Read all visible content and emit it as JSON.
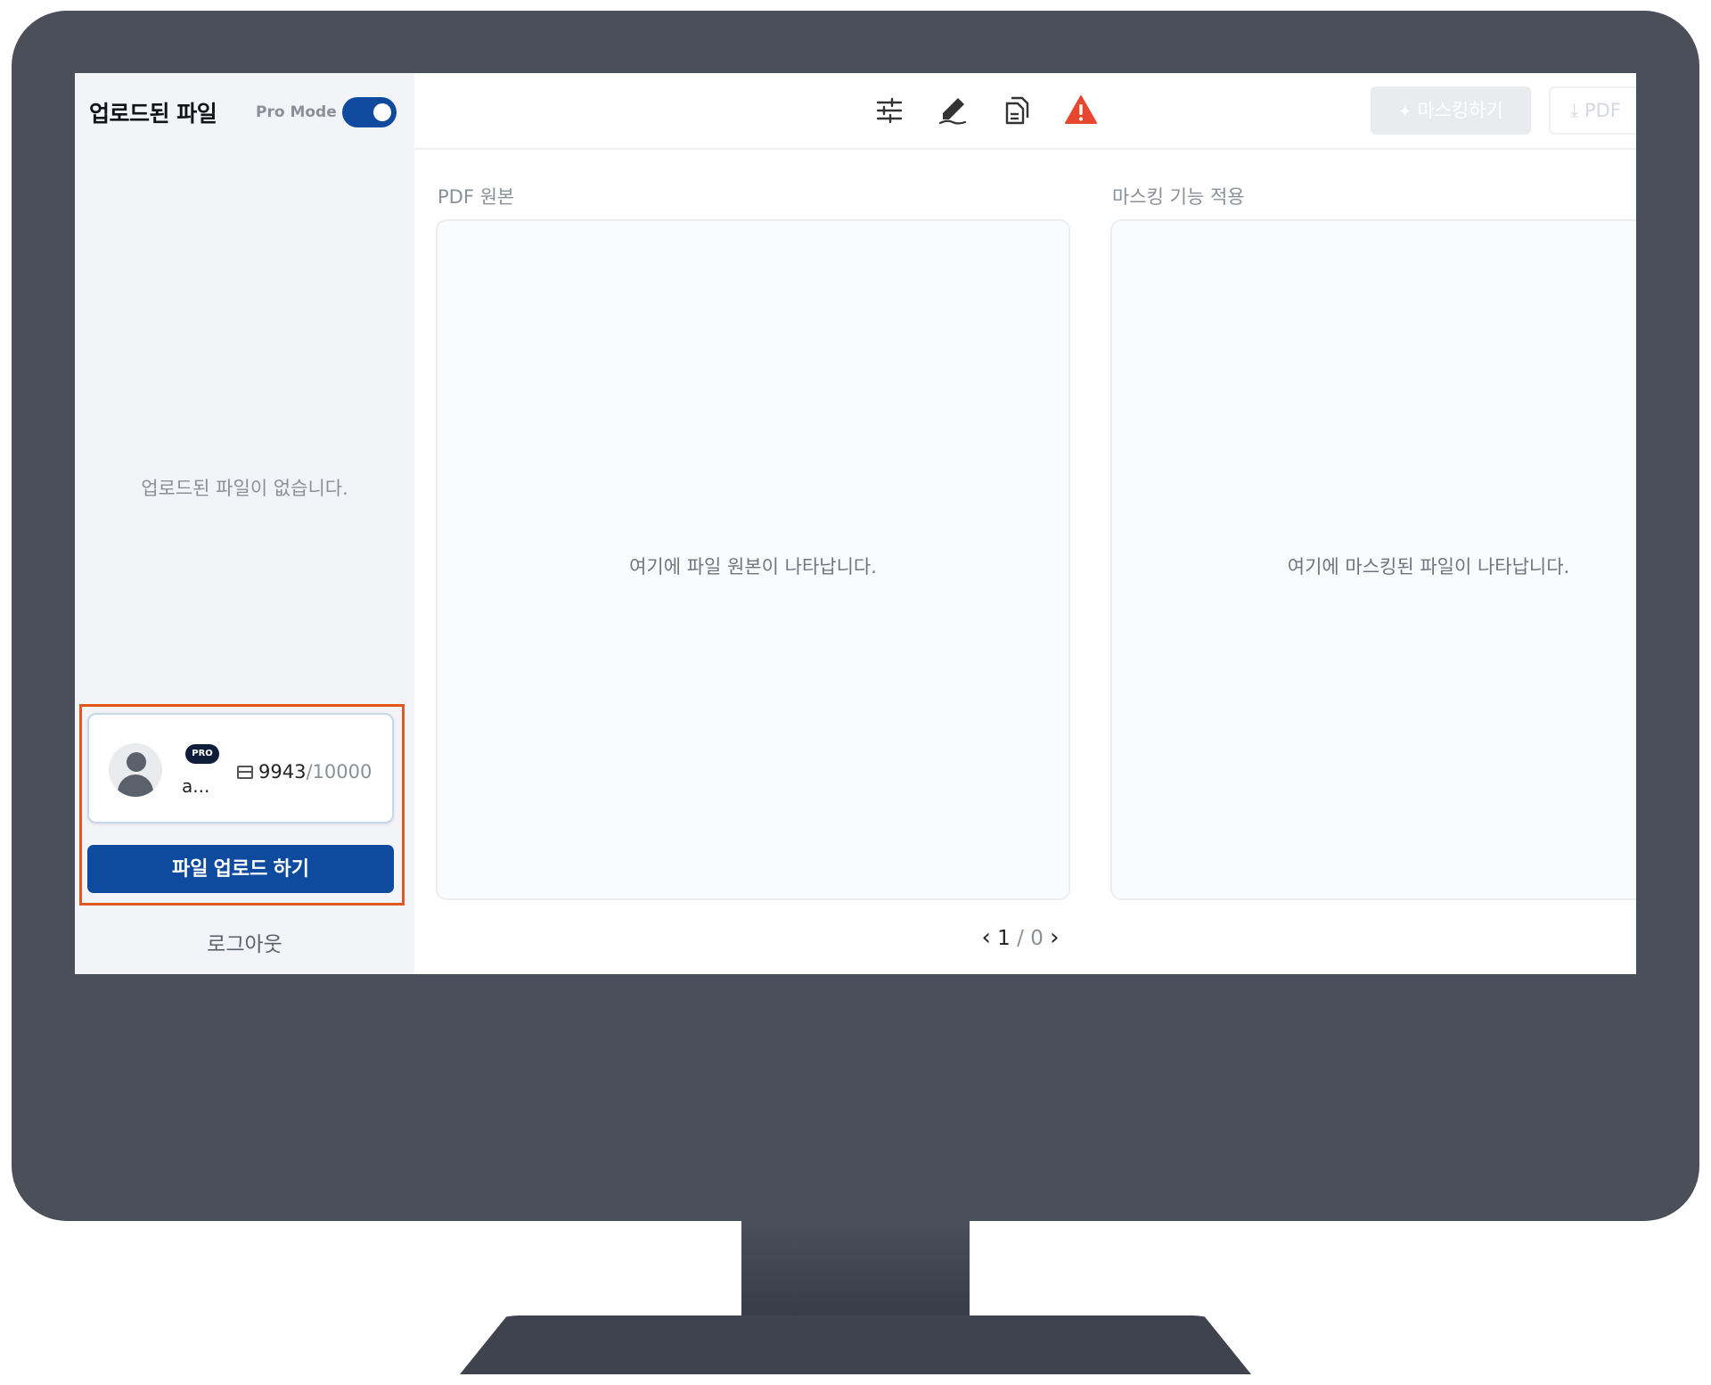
{
  "sidebar": {
    "title": "업로드된 파일",
    "mode_label": "Pro Mode",
    "mode_enabled": true,
    "empty_message": "업로드된 파일이 없습니다.",
    "user": {
      "badge": "PRO",
      "name": "a...",
      "quota_used": "9943",
      "quota_sep": "/",
      "quota_total": "10000"
    },
    "upload_button": "파일 업로드 하기",
    "logout": "로그아웃"
  },
  "toolbar": {
    "icons": [
      "sliders-icon",
      "pen-icon",
      "documents-icon",
      "warning-icon"
    ],
    "mask_button": "마스킹하기",
    "pdf_button": "PDF"
  },
  "panels": {
    "original_label": "PDF 원본",
    "original_message": "여기에 파일 원본이 나타납니다.",
    "masked_label": "마스킹 기능 적용",
    "masked_message": "여기에 마스킹된 파일이 나타납니다."
  },
  "pager": {
    "current": "1",
    "sep": "/",
    "total": "0"
  },
  "colors": {
    "accent": "#0e4a9d",
    "warning": "#e8472f",
    "highlight": "#e2561f",
    "bezel": "#4a4f5a"
  }
}
